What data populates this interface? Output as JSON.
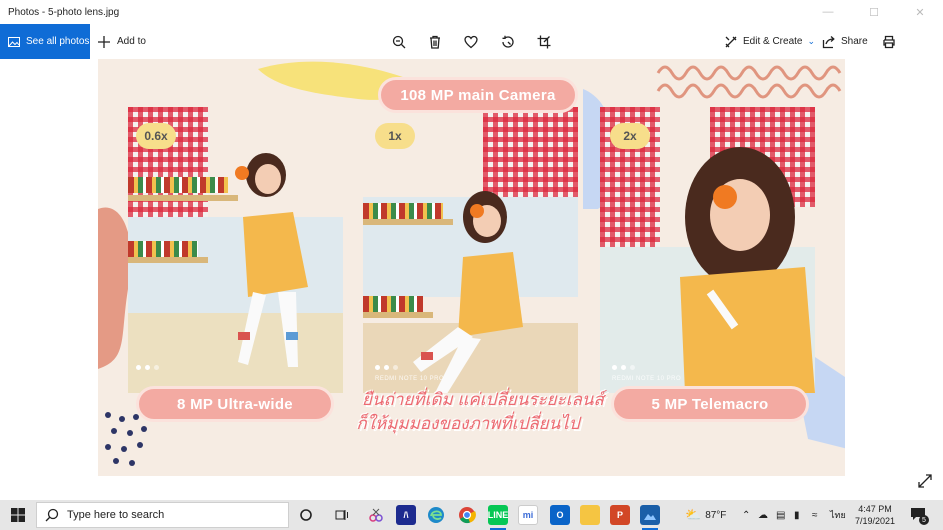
{
  "window": {
    "title": "Photos - 5-photo lens.jpg",
    "controls": [
      "minimize",
      "maximize",
      "close"
    ]
  },
  "toolbar": {
    "see_all_photos": "See all photos",
    "add_to": "Add to",
    "tools": [
      "zoom-icon",
      "delete-icon",
      "favorite-icon",
      "rotate-icon",
      "crop-icon"
    ],
    "edit_create": "Edit & Create",
    "share": "Share",
    "print_icon": "print-icon"
  },
  "photo": {
    "headline": "108 MP main Camera",
    "panels": [
      {
        "zoom": "0.6x",
        "label": "8 MP Ultra-wide",
        "watermark": ""
      },
      {
        "zoom": "1x",
        "label": "",
        "watermark": "REDMI NOTE 10 PRO"
      },
      {
        "zoom": "2x",
        "label": "5 MP Telemacro",
        "watermark": "REDMI NOTE 10 PRO"
      }
    ],
    "caption_line1": "ยืนถ่ายที่เดิม แค่เปลี่ยนระยะเลนส์",
    "caption_line2": "ก็ให้มุมมองของภาพที่เปลี่ยนไป",
    "colors": {
      "pill": "#f3aaa2",
      "badge": "#f7de8b",
      "background": "#f6ece3",
      "accent_blue": "#0f6cd6"
    }
  },
  "taskbar": {
    "search_placeholder": "Type here to search",
    "apps": [
      "task-view-icon",
      "snip-icon",
      "ps-icon",
      "app-icon",
      "edge-icon",
      "chrome-icon",
      "line-icon",
      "mi-icon",
      "outlook-icon",
      "explorer-icon",
      "powerpoint-icon",
      "photos-icon"
    ],
    "weather": "87°F",
    "language": "ไทย",
    "time": "4:47 PM",
    "date": "7/19/2021",
    "notifications": "5"
  }
}
